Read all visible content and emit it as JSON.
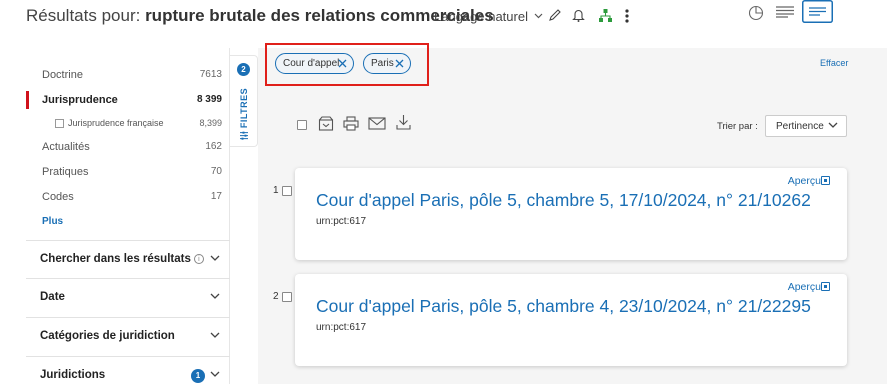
{
  "header": {
    "title_prefix": "Résultats pour: ",
    "query": "rupture brutale des relations commerciales",
    "search_mode": "Langage naturel"
  },
  "sidebar": {
    "categories": [
      {
        "label": "Doctrine",
        "count": "7613"
      },
      {
        "label": "Jurisprudence",
        "count": "8 399"
      },
      {
        "label": "Jurisprudence française",
        "count": "8,399"
      },
      {
        "label": "Actualités",
        "count": "162"
      },
      {
        "label": "Pratiques",
        "count": "70"
      },
      {
        "label": "Codes",
        "count": "17"
      },
      {
        "label": "Plus",
        "count": ""
      }
    ],
    "facets": [
      {
        "label": "Chercher dans les résultats"
      },
      {
        "label": "Date"
      },
      {
        "label": "Catégories de juridiction"
      },
      {
        "label": "Juridictions",
        "badge": "1"
      }
    ]
  },
  "filters_tab": {
    "count": "2",
    "label": "FILTRES"
  },
  "filters": {
    "chips": [
      {
        "label": "Cour d'appel"
      },
      {
        "label": "Paris"
      }
    ],
    "clear_label": "Effacer"
  },
  "sort": {
    "label": "Trier par :",
    "value": "Pertinence"
  },
  "results": [
    {
      "num": "1",
      "preview": "Aperçu",
      "title": "Cour d'appel Paris, pôle 5, chambre 5, 17/10/2024, n° 21/10262",
      "urn": "urn:pct:617"
    },
    {
      "num": "2",
      "preview": "Aperçu",
      "title": "Cour d'appel Paris, pôle 5, chambre 4, 23/10/2024, n° 21/22295",
      "urn": "urn:pct:617"
    }
  ],
  "colors": {
    "accent": "#1a6fb5",
    "active_marker": "#d0121b",
    "highlight_box": "#e0201a"
  },
  "icons": [
    "chevron-down-icon",
    "pencil-icon",
    "bell-icon",
    "hierarchy-icon",
    "more-vertical-icon",
    "pie-chart-icon",
    "list-view-icon",
    "card-view-icon",
    "archive-icon",
    "print-icon",
    "mail-icon",
    "download-icon",
    "close-icon",
    "info-icon",
    "preview-icon"
  ]
}
